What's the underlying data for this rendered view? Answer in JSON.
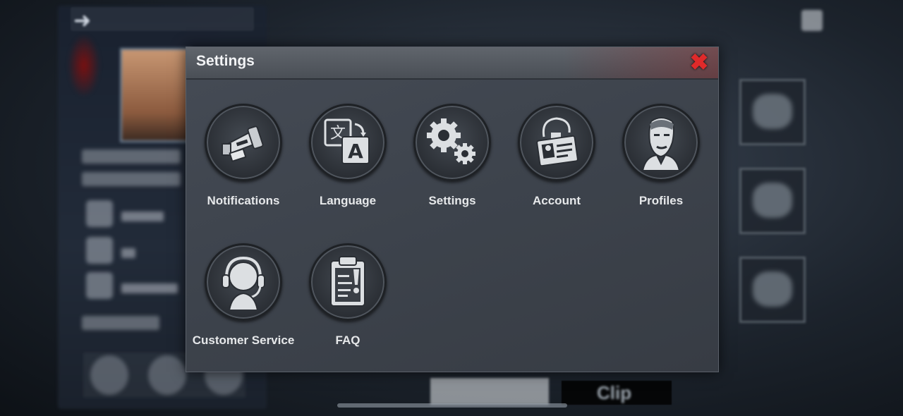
{
  "background": {
    "bottom_button_label": "Clip"
  },
  "dialog": {
    "title": "Settings",
    "close_symbol": "✖",
    "items": [
      {
        "label": "Notifications",
        "icon": "megaphone-icon"
      },
      {
        "label": "Language",
        "icon": "translate-icon"
      },
      {
        "label": "Settings",
        "icon": "gears-icon"
      },
      {
        "label": "Account",
        "icon": "id-badge-icon"
      },
      {
        "label": "Profiles",
        "icon": "portrait-icon"
      },
      {
        "label": "Customer Service",
        "icon": "headset-icon"
      },
      {
        "label": "FAQ",
        "icon": "clipboard-icon"
      }
    ]
  },
  "colors": {
    "accent_close": "#e02a2a",
    "dialog_bg": "#3d434c",
    "label_text": "#e6e8ea"
  }
}
